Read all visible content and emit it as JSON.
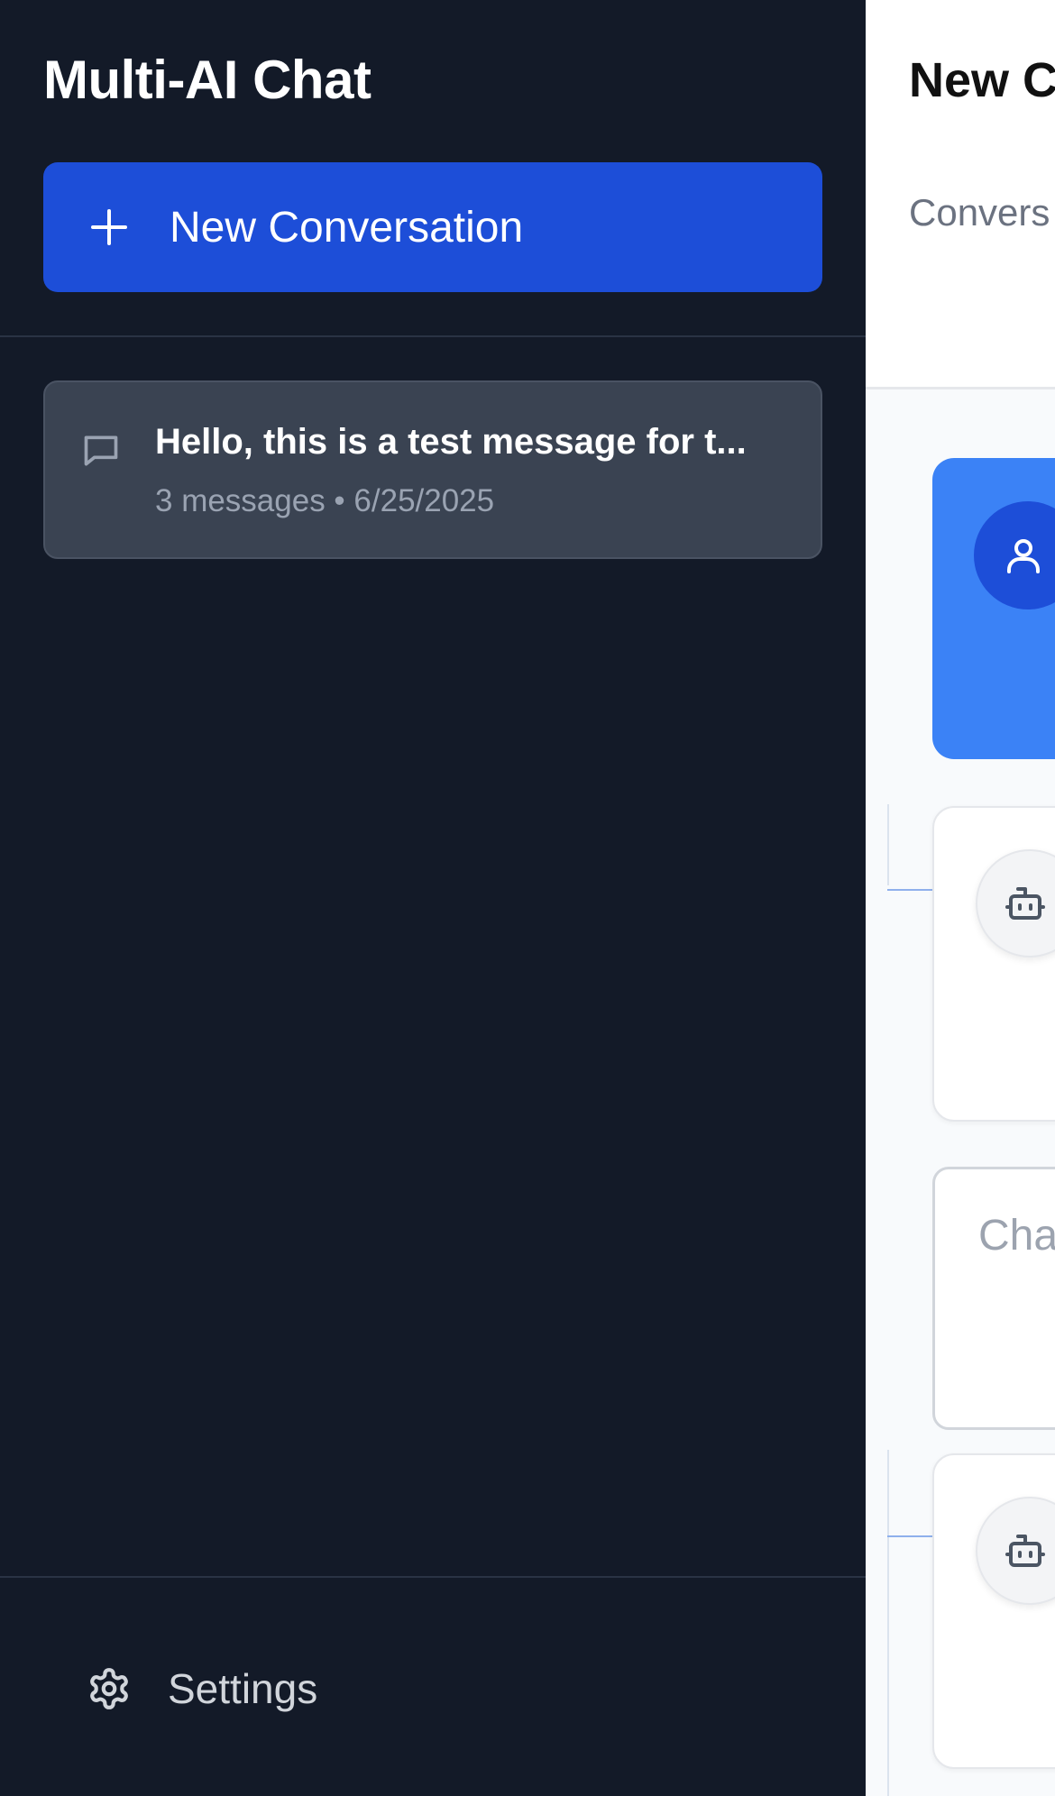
{
  "sidebar": {
    "app_title": "Multi-AI Chat",
    "new_conversation_label": "New Conversation",
    "conversations": [
      {
        "title": "Hello, this is a test message for t...",
        "meta": "3 messages • 6/25/2025"
      }
    ],
    "settings_label": "Settings"
  },
  "main": {
    "title": "New C",
    "view_tab_label": "Convers Tree",
    "input_placeholder": "Cha prov"
  },
  "colors": {
    "sidebar_bg": "#131a28",
    "accent": "#1d4ed8",
    "user_message_bg": "#3b82f6",
    "conversation_item_bg": "#3a4352"
  },
  "icons": [
    "plus-icon",
    "chat-bubble-icon",
    "gear-icon",
    "user-icon",
    "bot-icon"
  ]
}
